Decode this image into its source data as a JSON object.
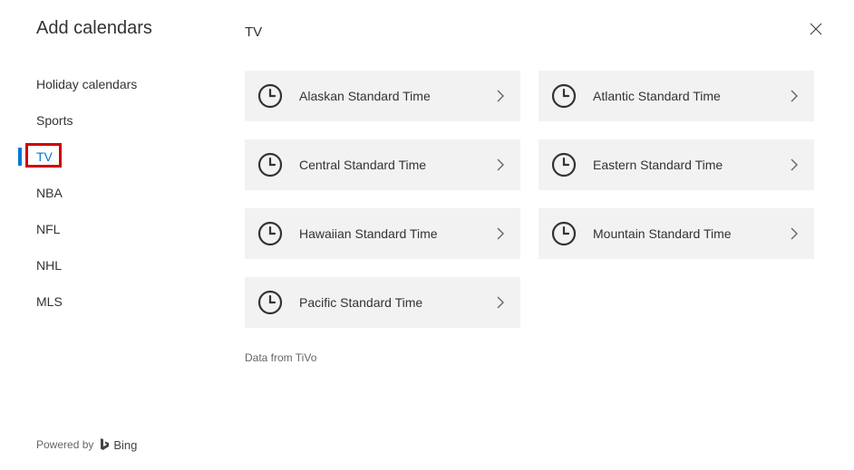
{
  "sidebar": {
    "title": "Add calendars",
    "items": [
      {
        "label": "Holiday calendars",
        "selected": false
      },
      {
        "label": "Sports",
        "selected": false
      },
      {
        "label": "TV",
        "selected": true
      },
      {
        "label": "NBA",
        "selected": false
      },
      {
        "label": "NFL",
        "selected": false
      },
      {
        "label": "NHL",
        "selected": false
      },
      {
        "label": "MLS",
        "selected": false
      }
    ]
  },
  "footer": {
    "powered_by": "Powered by",
    "brand": "Bing"
  },
  "main": {
    "title": "TV",
    "cards": [
      {
        "label": "Alaskan Standard Time"
      },
      {
        "label": "Atlantic Standard Time"
      },
      {
        "label": "Central Standard Time"
      },
      {
        "label": "Eastern Standard Time"
      },
      {
        "label": "Hawaiian Standard Time"
      },
      {
        "label": "Mountain Standard Time"
      },
      {
        "label": "Pacific Standard Time"
      }
    ],
    "data_source": "Data from TiVo"
  }
}
